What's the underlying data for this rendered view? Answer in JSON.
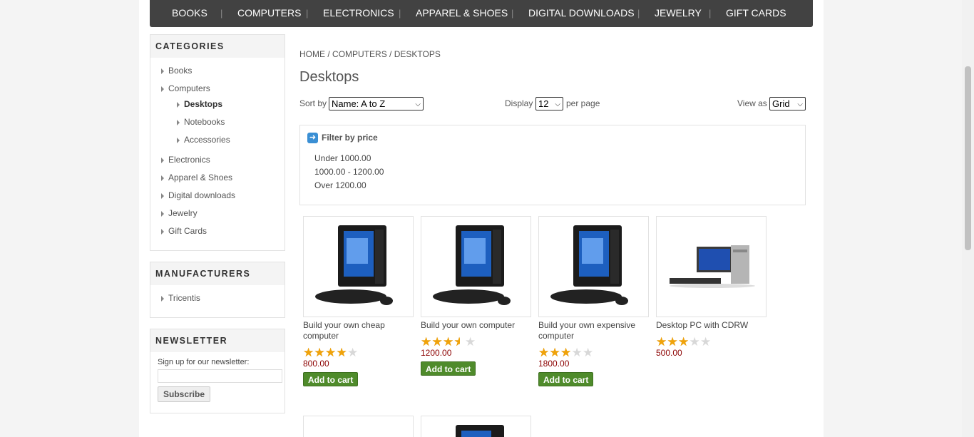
{
  "topmenu": [
    "BOOKS",
    "COMPUTERS",
    "ELECTRONICS",
    "APPAREL & SHOES",
    "DIGITAL DOWNLOADS",
    "JEWELRY",
    "GIFT CARDS"
  ],
  "categories": {
    "title": "CATEGORIES",
    "items": [
      "Books",
      "Computers",
      "Desktops",
      "Notebooks",
      "Accessories",
      "Electronics",
      "Apparel & Shoes",
      "Digital downloads",
      "Jewelry",
      "Gift Cards"
    ]
  },
  "manufacturers": {
    "title": "MANUFACTURERS",
    "items": [
      "Tricentis"
    ]
  },
  "newsletter": {
    "title": "NEWSLETTER",
    "label": "Sign up for our newsletter:",
    "input_value": "",
    "button": "Subscribe"
  },
  "breadcrumb": {
    "home": "HOME",
    "computers": "COMPUTERS",
    "current": "DESKTOPS",
    "sep": "/"
  },
  "page_title": "Desktops",
  "sort": {
    "label": "Sort by",
    "value": "Name: A to Z"
  },
  "display": {
    "label": "Display",
    "value": "12",
    "suffix": "per page"
  },
  "viewas": {
    "label": "View as",
    "value": "Grid"
  },
  "filter": {
    "title": "Filter by price",
    "ranges": [
      "Under 1000.00",
      "1000.00 - 1200.00",
      "Over 1200.00"
    ]
  },
  "products": [
    {
      "name": "Build your own cheap computer",
      "rating": 4,
      "price": "800.00",
      "cart": "Add to cart"
    },
    {
      "name": "Build your own computer",
      "rating": 3.5,
      "price": "1200.00",
      "cart": "Add to cart"
    },
    {
      "name": "Build your own expensive computer",
      "rating": 3,
      "price": "1800.00",
      "cart": "Add to cart"
    },
    {
      "name": "Desktop PC with CDRW",
      "rating": 3,
      "price": "500.00",
      "cart": ""
    }
  ],
  "icons": [
    "arrow-right-icon",
    "triangle-right-icon",
    "chevron-down-icon",
    "star-icon"
  ]
}
